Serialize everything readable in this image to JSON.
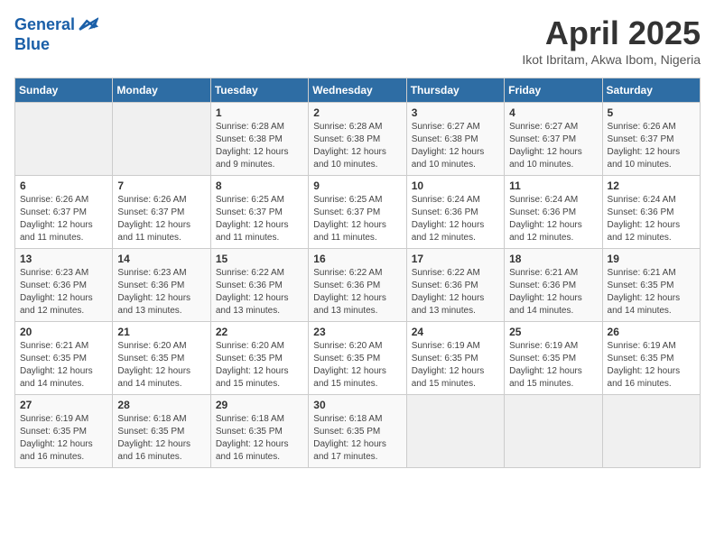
{
  "header": {
    "logo_line1": "General",
    "logo_line2": "Blue",
    "month_title": "April 2025",
    "subtitle": "Ikot Ibritam, Akwa Ibom, Nigeria"
  },
  "weekdays": [
    "Sunday",
    "Monday",
    "Tuesday",
    "Wednesday",
    "Thursday",
    "Friday",
    "Saturday"
  ],
  "weeks": [
    [
      {
        "day": "",
        "info": ""
      },
      {
        "day": "",
        "info": ""
      },
      {
        "day": "1",
        "info": "Sunrise: 6:28 AM\nSunset: 6:38 PM\nDaylight: 12 hours and 9 minutes."
      },
      {
        "day": "2",
        "info": "Sunrise: 6:28 AM\nSunset: 6:38 PM\nDaylight: 12 hours and 10 minutes."
      },
      {
        "day": "3",
        "info": "Sunrise: 6:27 AM\nSunset: 6:38 PM\nDaylight: 12 hours and 10 minutes."
      },
      {
        "day": "4",
        "info": "Sunrise: 6:27 AM\nSunset: 6:37 PM\nDaylight: 12 hours and 10 minutes."
      },
      {
        "day": "5",
        "info": "Sunrise: 6:26 AM\nSunset: 6:37 PM\nDaylight: 12 hours and 10 minutes."
      }
    ],
    [
      {
        "day": "6",
        "info": "Sunrise: 6:26 AM\nSunset: 6:37 PM\nDaylight: 12 hours and 11 minutes."
      },
      {
        "day": "7",
        "info": "Sunrise: 6:26 AM\nSunset: 6:37 PM\nDaylight: 12 hours and 11 minutes."
      },
      {
        "day": "8",
        "info": "Sunrise: 6:25 AM\nSunset: 6:37 PM\nDaylight: 12 hours and 11 minutes."
      },
      {
        "day": "9",
        "info": "Sunrise: 6:25 AM\nSunset: 6:37 PM\nDaylight: 12 hours and 11 minutes."
      },
      {
        "day": "10",
        "info": "Sunrise: 6:24 AM\nSunset: 6:36 PM\nDaylight: 12 hours and 12 minutes."
      },
      {
        "day": "11",
        "info": "Sunrise: 6:24 AM\nSunset: 6:36 PM\nDaylight: 12 hours and 12 minutes."
      },
      {
        "day": "12",
        "info": "Sunrise: 6:24 AM\nSunset: 6:36 PM\nDaylight: 12 hours and 12 minutes."
      }
    ],
    [
      {
        "day": "13",
        "info": "Sunrise: 6:23 AM\nSunset: 6:36 PM\nDaylight: 12 hours and 12 minutes."
      },
      {
        "day": "14",
        "info": "Sunrise: 6:23 AM\nSunset: 6:36 PM\nDaylight: 12 hours and 13 minutes."
      },
      {
        "day": "15",
        "info": "Sunrise: 6:22 AM\nSunset: 6:36 PM\nDaylight: 12 hours and 13 minutes."
      },
      {
        "day": "16",
        "info": "Sunrise: 6:22 AM\nSunset: 6:36 PM\nDaylight: 12 hours and 13 minutes."
      },
      {
        "day": "17",
        "info": "Sunrise: 6:22 AM\nSunset: 6:36 PM\nDaylight: 12 hours and 13 minutes."
      },
      {
        "day": "18",
        "info": "Sunrise: 6:21 AM\nSunset: 6:36 PM\nDaylight: 12 hours and 14 minutes."
      },
      {
        "day": "19",
        "info": "Sunrise: 6:21 AM\nSunset: 6:35 PM\nDaylight: 12 hours and 14 minutes."
      }
    ],
    [
      {
        "day": "20",
        "info": "Sunrise: 6:21 AM\nSunset: 6:35 PM\nDaylight: 12 hours and 14 minutes."
      },
      {
        "day": "21",
        "info": "Sunrise: 6:20 AM\nSunset: 6:35 PM\nDaylight: 12 hours and 14 minutes."
      },
      {
        "day": "22",
        "info": "Sunrise: 6:20 AM\nSunset: 6:35 PM\nDaylight: 12 hours and 15 minutes."
      },
      {
        "day": "23",
        "info": "Sunrise: 6:20 AM\nSunset: 6:35 PM\nDaylight: 12 hours and 15 minutes."
      },
      {
        "day": "24",
        "info": "Sunrise: 6:19 AM\nSunset: 6:35 PM\nDaylight: 12 hours and 15 minutes."
      },
      {
        "day": "25",
        "info": "Sunrise: 6:19 AM\nSunset: 6:35 PM\nDaylight: 12 hours and 15 minutes."
      },
      {
        "day": "26",
        "info": "Sunrise: 6:19 AM\nSunset: 6:35 PM\nDaylight: 12 hours and 16 minutes."
      }
    ],
    [
      {
        "day": "27",
        "info": "Sunrise: 6:19 AM\nSunset: 6:35 PM\nDaylight: 12 hours and 16 minutes."
      },
      {
        "day": "28",
        "info": "Sunrise: 6:18 AM\nSunset: 6:35 PM\nDaylight: 12 hours and 16 minutes."
      },
      {
        "day": "29",
        "info": "Sunrise: 6:18 AM\nSunset: 6:35 PM\nDaylight: 12 hours and 16 minutes."
      },
      {
        "day": "30",
        "info": "Sunrise: 6:18 AM\nSunset: 6:35 PM\nDaylight: 12 hours and 17 minutes."
      },
      {
        "day": "",
        "info": ""
      },
      {
        "day": "",
        "info": ""
      },
      {
        "day": "",
        "info": ""
      }
    ]
  ]
}
